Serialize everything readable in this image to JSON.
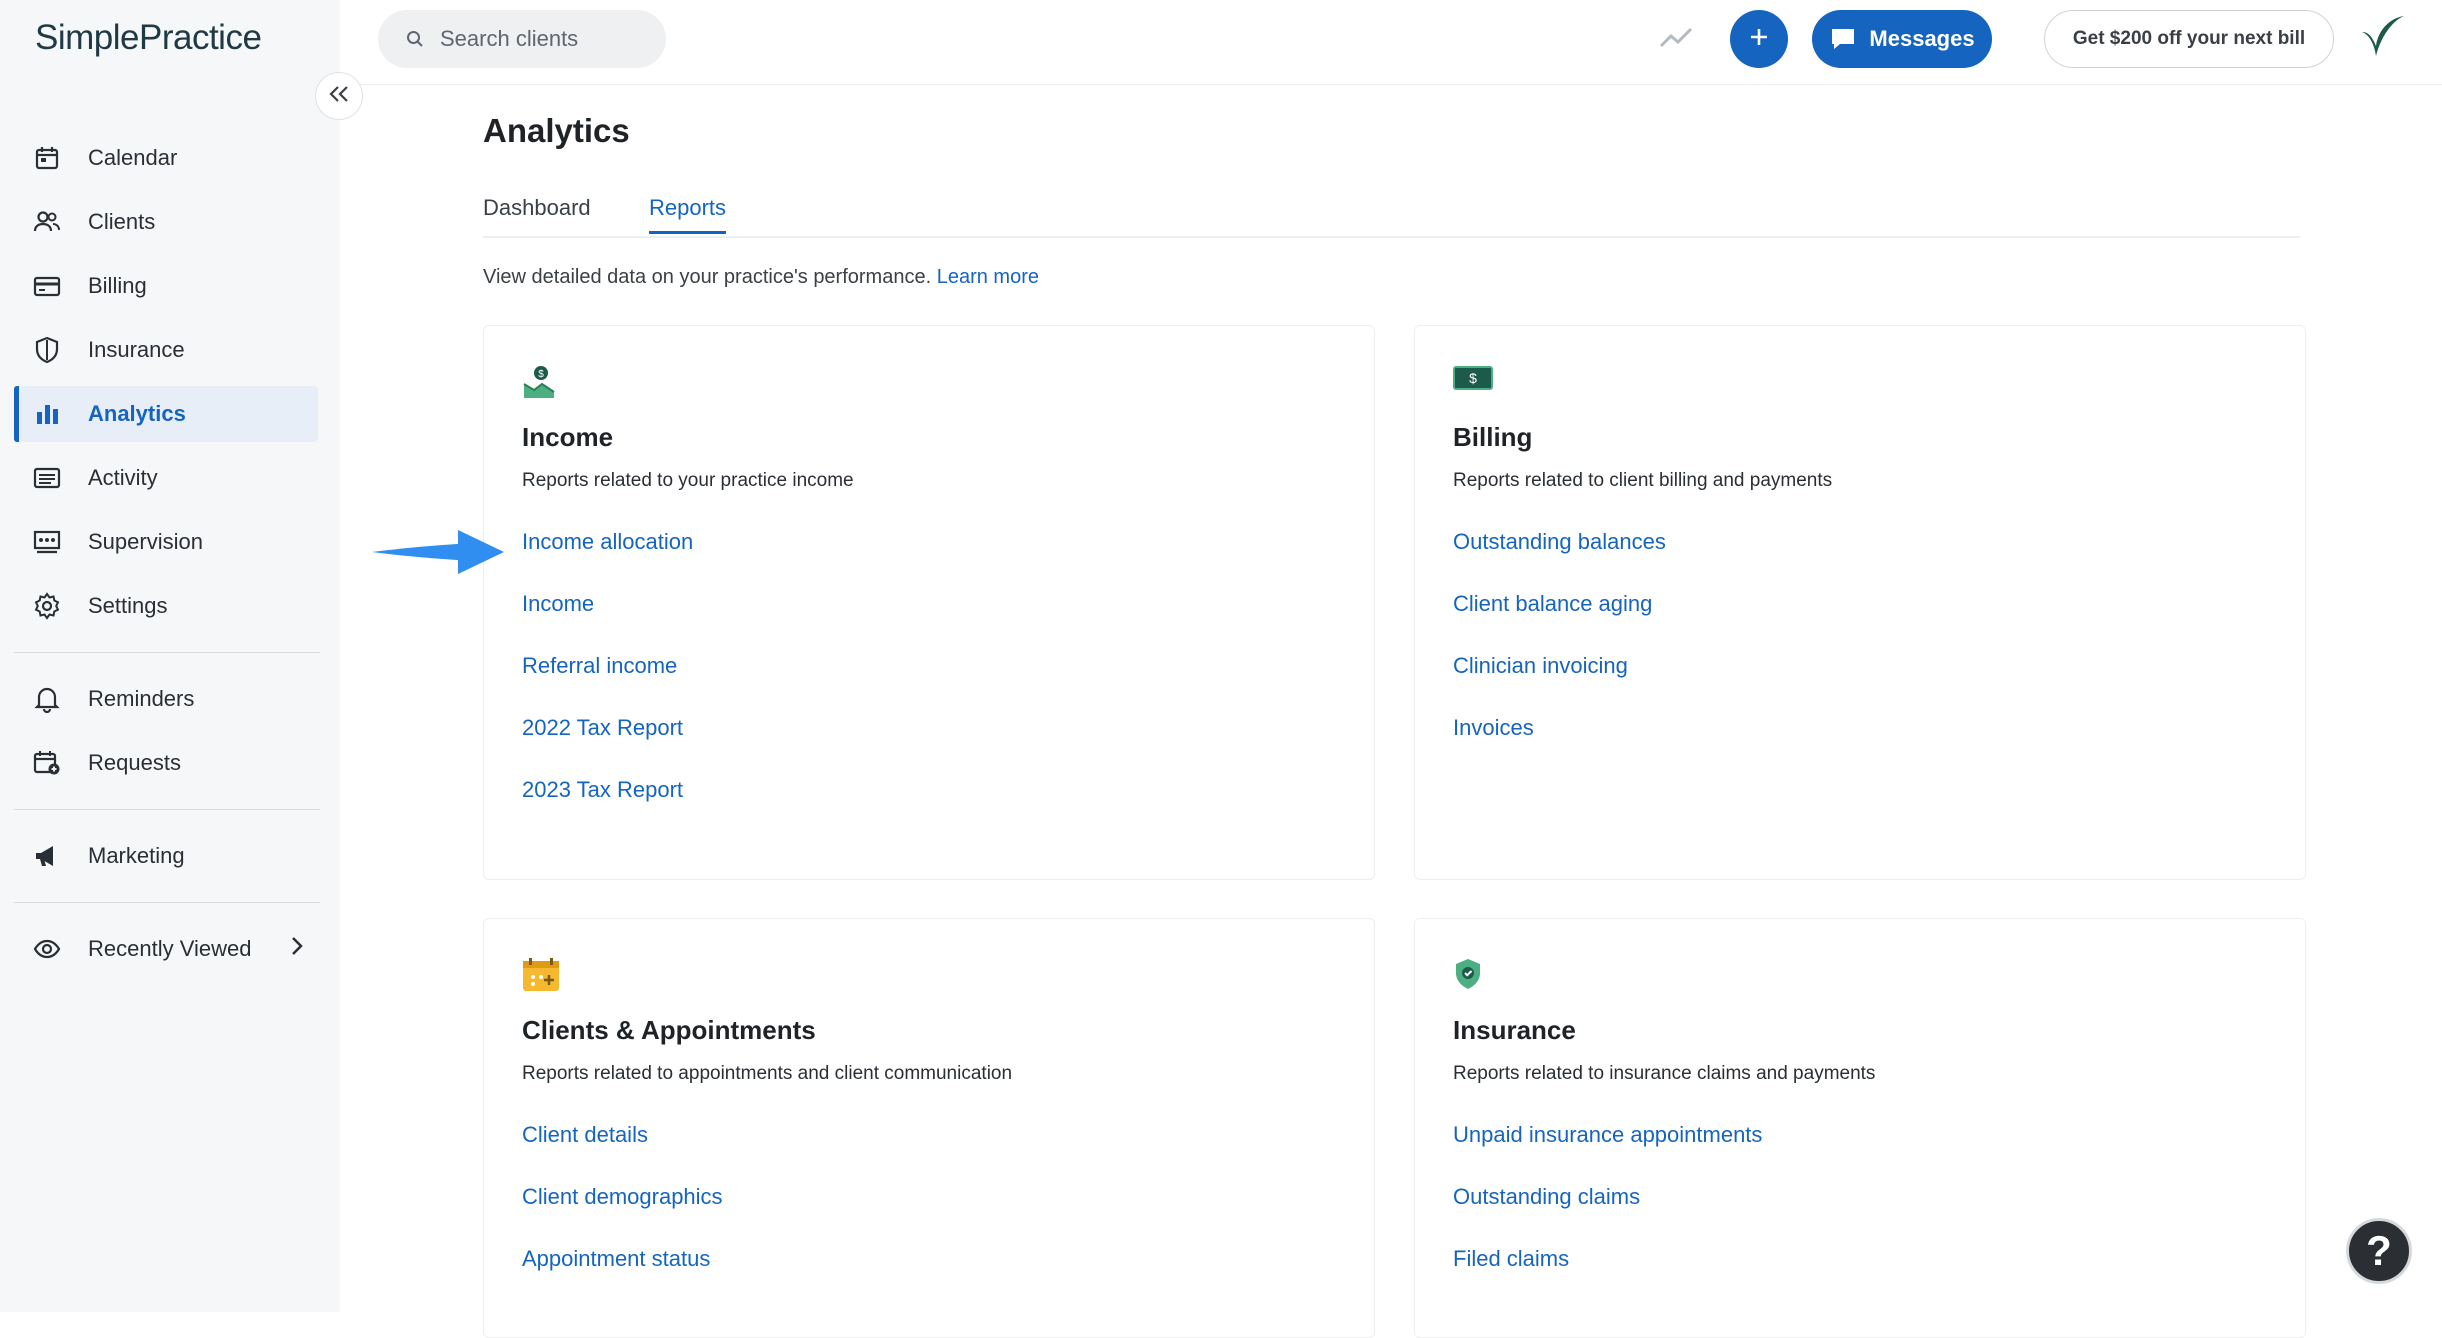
{
  "app": {
    "logo_text": "SimplePractice",
    "brand_color": "#1565c0"
  },
  "sidebar": {
    "items": [
      {
        "label": "Calendar",
        "icon": "calendar-icon"
      },
      {
        "label": "Clients",
        "icon": "clients-icon"
      },
      {
        "label": "Billing",
        "icon": "billing-icon"
      },
      {
        "label": "Insurance",
        "icon": "shield-icon"
      },
      {
        "label": "Analytics",
        "icon": "analytics-icon",
        "active": true
      },
      {
        "label": "Activity",
        "icon": "activity-icon"
      },
      {
        "label": "Supervision",
        "icon": "supervision-icon"
      },
      {
        "label": "Settings",
        "icon": "gear-icon"
      }
    ],
    "secondary": [
      {
        "label": "Reminders",
        "icon": "bell-icon"
      },
      {
        "label": "Requests",
        "icon": "requests-icon"
      }
    ],
    "marketing": {
      "label": "Marketing",
      "icon": "megaphone-icon"
    },
    "recently_viewed": {
      "label": "Recently Viewed",
      "icon": "eye-icon"
    }
  },
  "topbar": {
    "search_placeholder": "Search clients",
    "messages_label": "Messages",
    "promo_label": "Get $200 off your next bill"
  },
  "main": {
    "title": "Analytics",
    "tabs": [
      {
        "label": "Dashboard",
        "active": false
      },
      {
        "label": "Reports",
        "active": true
      }
    ],
    "intro_text": "View detailed data on your practice's performance.",
    "learn_more": "Learn more",
    "cards": [
      {
        "title": "Income",
        "description": "Reports related to your practice income",
        "icon": "income-icon",
        "links": [
          "Income allocation",
          "Income",
          "Referral income",
          "2022 Tax Report",
          "2023 Tax Report"
        ]
      },
      {
        "title": "Billing",
        "description": "Reports related to client billing and payments",
        "icon": "dollar-bill-icon",
        "links": [
          "Outstanding balances",
          "Client balance aging",
          "Clinician invoicing",
          "Invoices"
        ]
      },
      {
        "title": "Clients & Appointments",
        "description": "Reports related to appointments and client communication",
        "icon": "appointments-icon",
        "links": [
          "Client details",
          "Client demographics",
          "Appointment status"
        ]
      },
      {
        "title": "Insurance",
        "description": "Reports related to insurance claims and payments",
        "icon": "shield-check-icon",
        "links": [
          "Unpaid insurance appointments",
          "Outstanding claims",
          "Filed claims"
        ]
      }
    ]
  },
  "help_label": "?"
}
